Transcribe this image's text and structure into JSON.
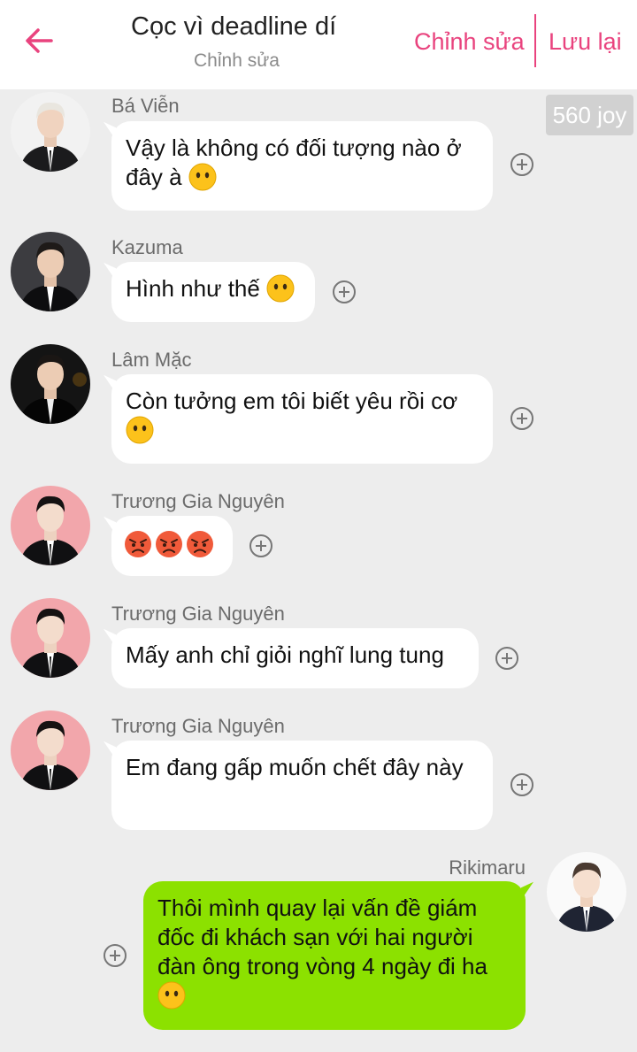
{
  "header": {
    "title": "Cọc vì deadline dí",
    "subtitle": "Chỉnh sửa",
    "edit_label": "Chỉnh sửa",
    "save_label": "Lưu lại",
    "accent_color": "#e9437e"
  },
  "joy_badge": "560 joy",
  "messages": [
    {
      "name": "Bá Viễn",
      "text": "Vậy là không có đối tượng nào ở đây à",
      "emoji": "neutral-face"
    },
    {
      "name": "Kazuma",
      "text": "Hình như thế",
      "emoji": "neutral-face"
    },
    {
      "name": "Lâm Mặc",
      "text": "Còn tưởng em tôi biết yêu rồi cơ",
      "emoji": "neutral-face"
    },
    {
      "name": "Trương Gia Nguyên",
      "text": "",
      "emoji": "angry-face x3"
    },
    {
      "name": "Trương Gia Nguyên",
      "text": "Mấy anh chỉ giỏi nghĩ lung tung"
    },
    {
      "name": "Trương Gia Nguyên",
      "text": "Em đang gấp muốn chết đây này"
    },
    {
      "name": "Rikimaru",
      "text": "Thôi mình quay lại vấn đề giám đốc đi khách sạn với hai người đàn ông trong vòng 4 ngày đi ha",
      "emoji": "neutral-face"
    }
  ],
  "colors": {
    "own_bubble": "#8ce100",
    "other_bubble": "#ffffff",
    "background": "#ededed"
  }
}
